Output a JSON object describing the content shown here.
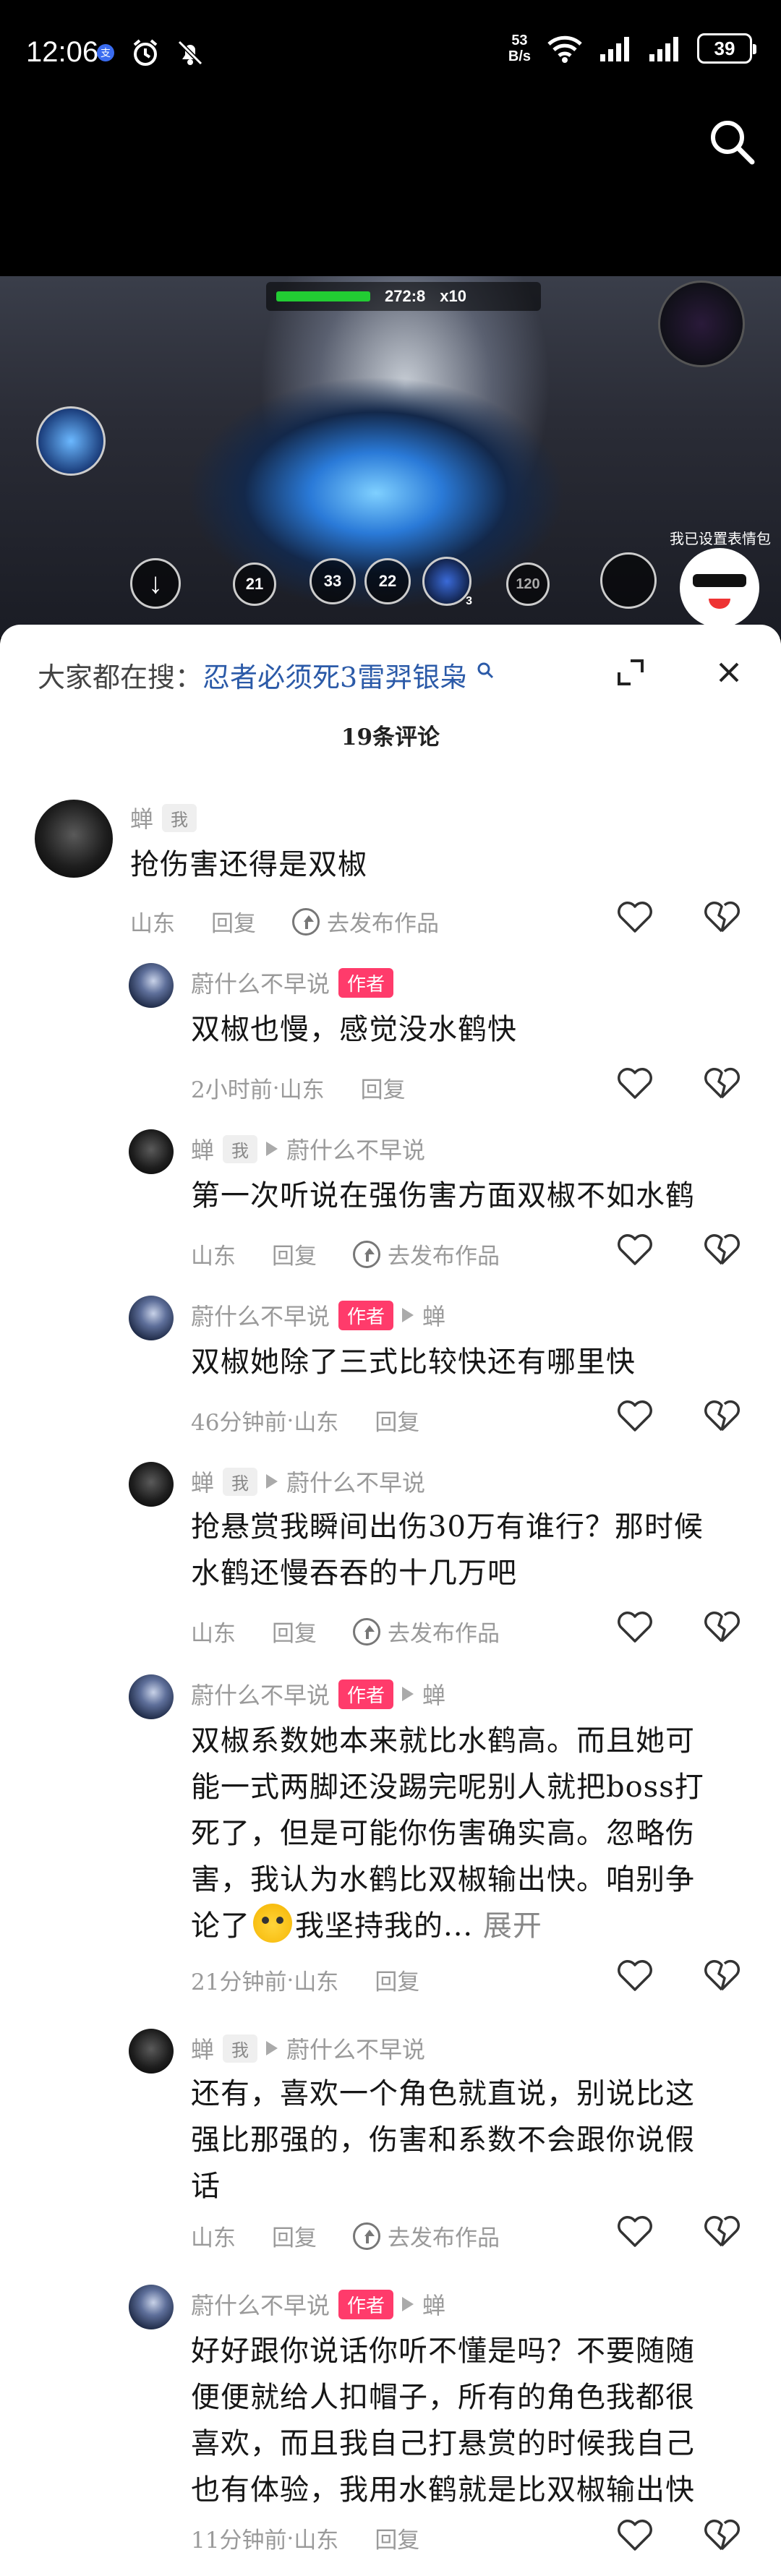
{
  "status_bar": {
    "time": "12:06",
    "net_speed_value": "53",
    "net_speed_unit": "B/s",
    "battery": "39"
  },
  "video": {
    "hud_time": "272:8",
    "hud_multiplier": "x10",
    "skills": [
      "21",
      "33",
      "22",
      "120"
    ],
    "skill_count": "3",
    "overlay_text": "我已设置表情包"
  },
  "sheet": {
    "hot_search_label": "大家都在搜：",
    "hot_search_term": "忍者必须死3雷羿银枭",
    "comment_count": "19条评论"
  },
  "comments": [
    {
      "user": "蝉",
      "tag": "我",
      "reply_to": "",
      "text": "抢伤害还得是双椒",
      "time": "",
      "location": "山东",
      "reply_label": "回复",
      "publish_label": "去发布作品"
    },
    {
      "user": "蔚什么不早说",
      "tag": "作者",
      "reply_to": "",
      "text": "双椒也慢，感觉没水鹤快",
      "time": "2小时前",
      "location": "山东",
      "reply_label": "回复",
      "publish_label": ""
    },
    {
      "user": "蝉",
      "tag": "我",
      "reply_to": "蔚什么不早说",
      "text": "第一次听说在强伤害方面双椒不如水鹤",
      "time": "",
      "location": "山东",
      "reply_label": "回复",
      "publish_label": "去发布作品"
    },
    {
      "user": "蔚什么不早说",
      "tag": "作者",
      "reply_to": "蝉",
      "text": "双椒她除了三式比较快还有哪里快",
      "time": "46分钟前",
      "location": "山东",
      "reply_label": "回复",
      "publish_label": ""
    },
    {
      "user": "蝉",
      "tag": "我",
      "reply_to": "蔚什么不早说",
      "text_lines": [
        "抢悬赏我瞬间出伤30万有谁行？那时候",
        "水鹤还慢吞吞的十几万吧"
      ],
      "time": "",
      "location": "山东",
      "reply_label": "回复",
      "publish_label": "去发布作品"
    },
    {
      "user": "蔚什么不早说",
      "tag": "作者",
      "reply_to": "蝉",
      "text_lines": [
        "双椒系数她本来就比水鹤高。而且她可",
        "能一式两脚还没踢完呢别人就把boss打",
        "死了，但是可能你伤害确实高。忽略伤",
        "害，我认为水鹤比双椒输出快。咱别争"
      ],
      "last_line_before": "论了",
      "last_line_after": "我坚持我的...",
      "expand_label": "展开",
      "time": "21分钟前",
      "location": "山东",
      "reply_label": "回复",
      "publish_label": ""
    },
    {
      "user": "蝉",
      "tag": "我",
      "reply_to": "蔚什么不早说",
      "text_lines": [
        "还有，喜欢一个角色就直说，别说比这",
        "强比那强的，伤害和系数不会跟你说假",
        "话"
      ],
      "time": "",
      "location": "山东",
      "reply_label": "回复",
      "publish_label": "去发布作品"
    },
    {
      "user": "蔚什么不早说",
      "tag": "作者",
      "reply_to": "蝉",
      "text_lines": [
        "好好跟你说话你听不懂是吗？不要随随",
        "便便就给人扣帽子，所有的角色我都很",
        "喜欢，而且我自己打悬赏的时候我自己",
        "也有体验，我用水鹤就是比双椒输出快"
      ],
      "time": "11分钟前",
      "location": "山东",
      "reply_label": "回复",
      "publish_label": ""
    }
  ],
  "icons": {
    "search": "search-icon",
    "expand": "expand-icon",
    "close": "close-icon",
    "like": "heart-icon",
    "dislike": "broken-heart-icon",
    "publish": "upload-circle-icon"
  }
}
